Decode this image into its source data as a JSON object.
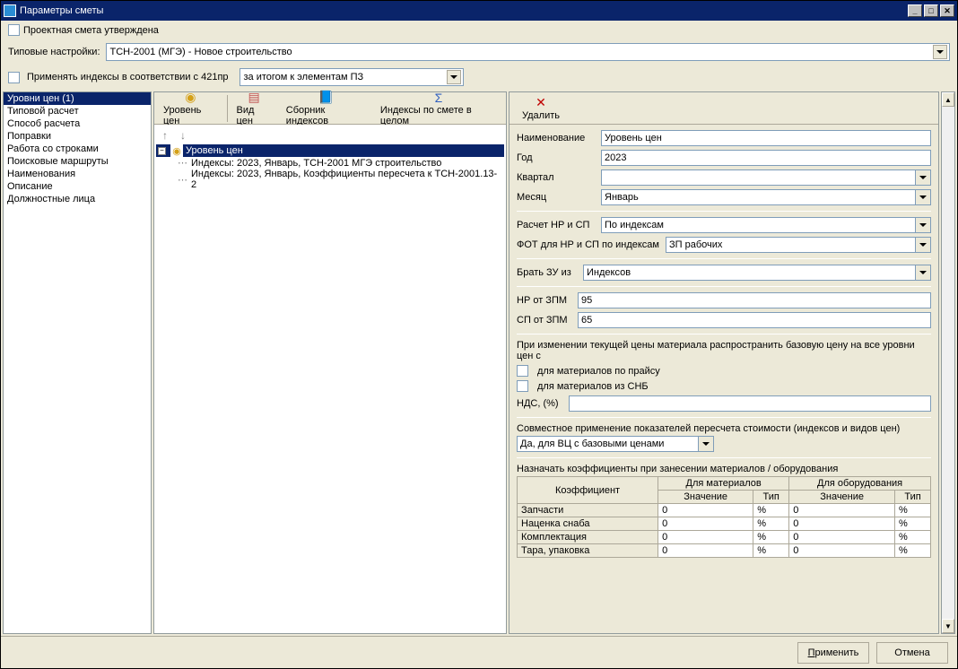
{
  "title": "Параметры сметы",
  "approval_checkbox_label": "Проектная смета утверждена",
  "typical_settings_label": "Типовые настройки:",
  "typical_settings_value": "ТСН-2001 (МГЭ) - Новое строительство",
  "apply_indexes_label": "Применять индексы в соответствии с 421пр",
  "apply_indexes_combo": "за итогом к элементам ПЗ",
  "left_items": [
    "Уровни цен (1)",
    "Типовой расчет",
    "Способ расчета",
    "Поправки",
    "Работа со строками",
    "Поисковые маршруты",
    "Наименования",
    "Описание",
    "Должностные лица"
  ],
  "tb": {
    "level": "Уровень цен",
    "view": "Вид цен",
    "collection": "Сборник индексов",
    "overall": "Индексы по смете в целом"
  },
  "tree": {
    "root": "Уровень цен",
    "child1": "Индексы: 2023, Январь, ТСН-2001 МГЭ строительство",
    "child2": "Индексы: 2023, Январь, Коэффициенты пересчета к ТСН-2001.13-2"
  },
  "del_label": "Удалить",
  "detail": {
    "name_label": "Наименование",
    "name_value": "Уровень цен",
    "year_label": "Год",
    "year_value": "2023",
    "quarter_label": "Квартал",
    "quarter_value": "",
    "month_label": "Месяц",
    "month_value": "Январь",
    "nrsp_label": "Расчет НР и СП",
    "nrsp_value": "По индексам",
    "fot_label": "ФОТ для НР и СП по индексам",
    "fot_value": "ЗП рабочих",
    "zu_label": "Брать ЗУ из",
    "zu_value": "Индексов",
    "nr_zpm_label": "НР от ЗПМ",
    "nr_zpm_value": "95",
    "sp_zpm_label": "СП от ЗПМ",
    "sp_zpm_value": "65",
    "propagate_label": "При изменении текущей цены материала распространить базовую цену на все уровни цен с",
    "chk_price": "для материалов по прайсу",
    "chk_snb": "для материалов из СНБ",
    "nds_label": "НДС, (%)",
    "joint_label": "Совместное применение показателей пересчета стоимости (индексов и видов цен)",
    "joint_value": "Да, для ВЦ с базовыми ценами",
    "assign_label": "Назначать коэффициенты при занесении материалов / оборудования",
    "table": {
      "h_coef": "Коэффициент",
      "h_mat": "Для материалов",
      "h_equip": "Для оборудования",
      "h_val": "Значение",
      "h_type": "Тип",
      "r1": "Запчасти",
      "r2": "Наценка снаба",
      "r3": "Комплектация",
      "r4": "Тара, упаковка",
      "zero": "0",
      "pct": "%"
    }
  },
  "footer": {
    "apply": "Применить",
    "cancel": "Отмена"
  }
}
